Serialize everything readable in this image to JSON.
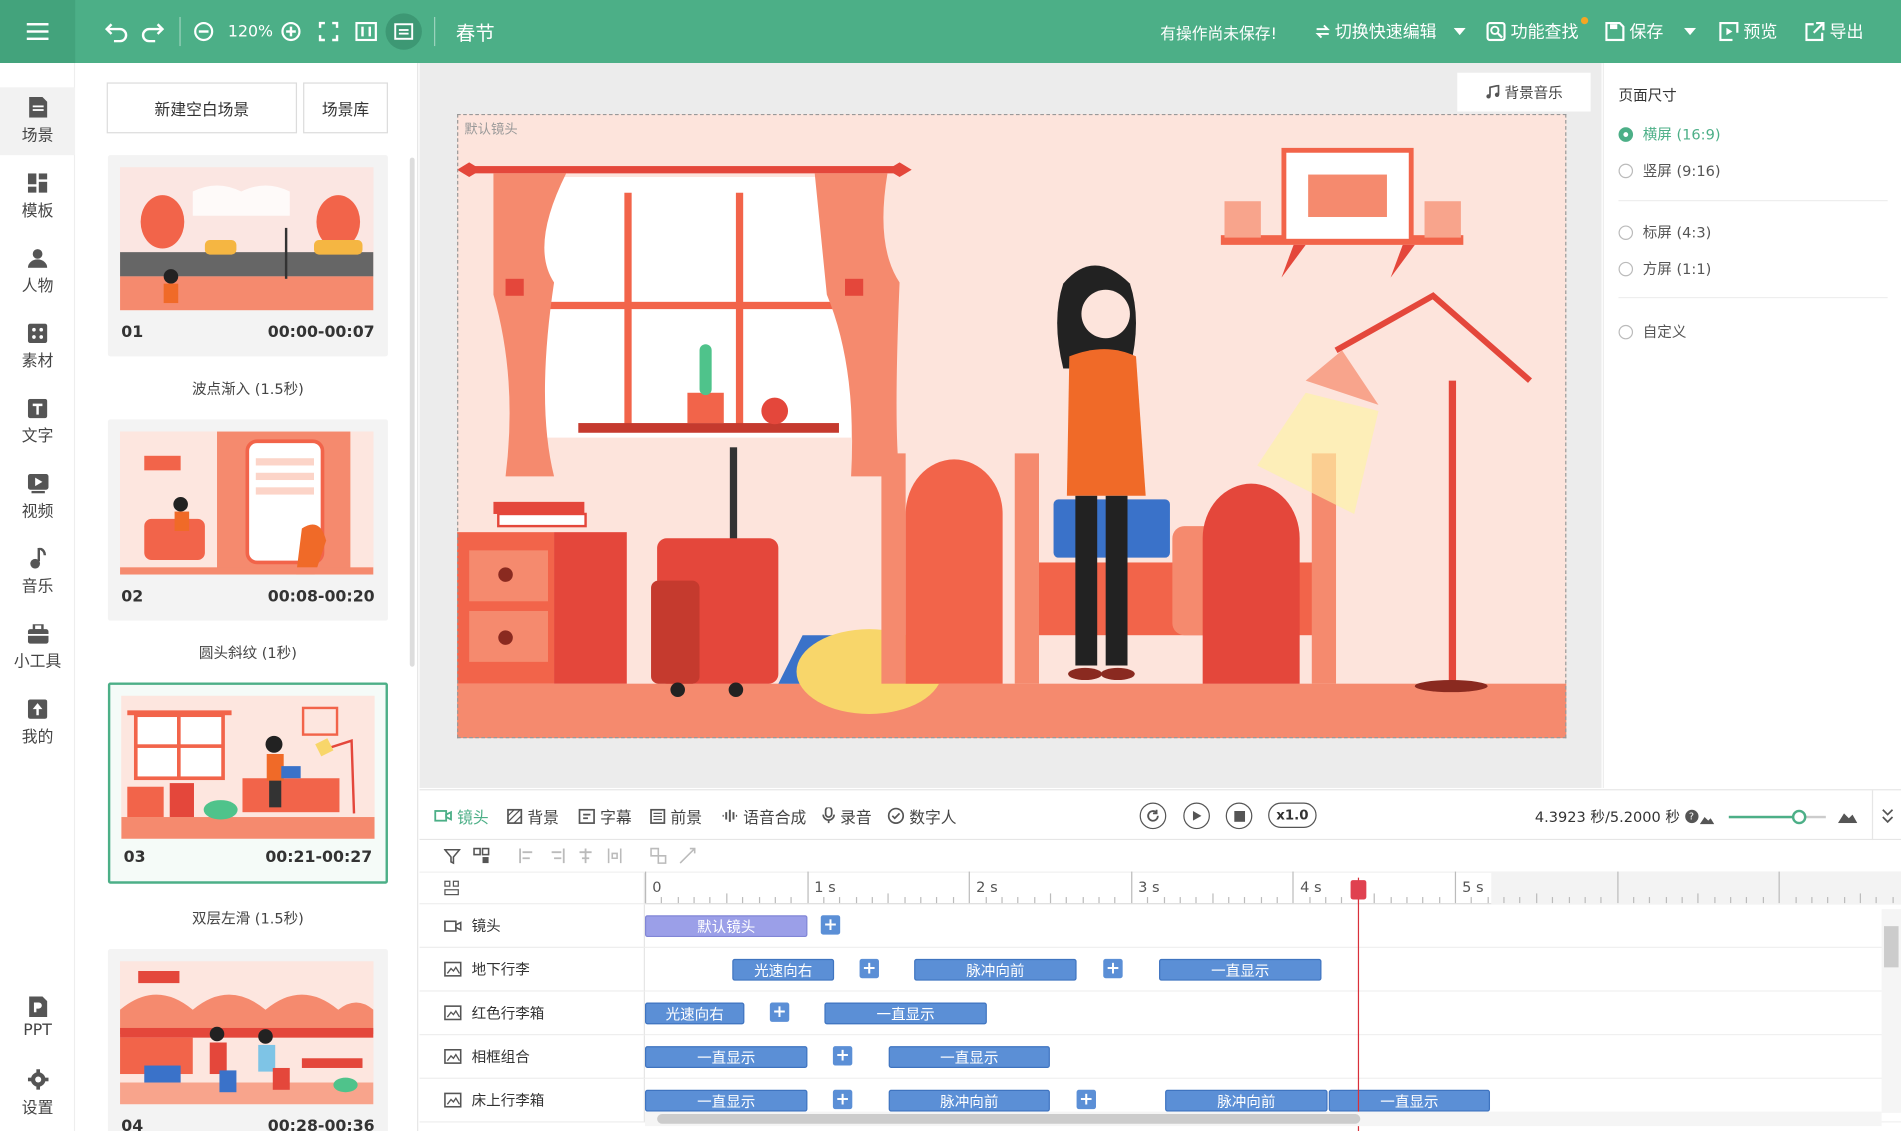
{
  "toolbar": {
    "zoom": "120%",
    "doc_title": "春节",
    "unsaved_notice": "有操作尚未保存!",
    "quick_edit": "切换快速编辑",
    "feature_search": "功能查找",
    "save": "保存",
    "preview": "预览",
    "export": "导出"
  },
  "nav": {
    "items": [
      {
        "label": "场景",
        "icon": "scene-icon"
      },
      {
        "label": "模板",
        "icon": "template-icon"
      },
      {
        "label": "人物",
        "icon": "person-icon"
      },
      {
        "label": "素材",
        "icon": "material-icon"
      },
      {
        "label": "文字",
        "icon": "text-icon"
      },
      {
        "label": "视频",
        "icon": "video-icon"
      },
      {
        "label": "音乐",
        "icon": "music-icon"
      },
      {
        "label": "小工具",
        "icon": "toolbox-icon"
      },
      {
        "label": "我的",
        "icon": "upload-icon"
      },
      {
        "label": "PPT",
        "icon": "ppt-icon"
      },
      {
        "label": "设置",
        "icon": "gear-icon"
      }
    ]
  },
  "scenes": {
    "new_blank": "新建空白场景",
    "library": "场景库",
    "cards": [
      {
        "num": "01",
        "time": "00:00-00:07",
        "transition": "波点渐入 (1.5秒)"
      },
      {
        "num": "02",
        "time": "00:08-00:20",
        "transition": "圆头斜纹 (1秒)"
      },
      {
        "num": "03",
        "time": "00:21-00:27",
        "transition": "双层左滑 (1.5秒)"
      },
      {
        "num": "04",
        "time": "00:28-00:36"
      }
    ]
  },
  "canvas": {
    "bgm": "背景音乐",
    "lens_label": "默认镜头"
  },
  "page_size": {
    "title": "页面尺寸",
    "options": [
      {
        "label": "横屏 (16:9)",
        "selected": true
      },
      {
        "label": "竖屏 (9:16)",
        "selected": false
      },
      {
        "label": "标屏 (4:3)",
        "selected": false
      },
      {
        "label": "方屏 (1:1)",
        "selected": false
      },
      {
        "label": "自定义",
        "selected": false
      }
    ]
  },
  "timeline": {
    "tabs": [
      "镜头",
      "背景",
      "字幕",
      "前景",
      "语音合成",
      "录音",
      "数字人"
    ],
    "speed": "x1.0",
    "time_readout": "4.3923 秒/5.2000 秒",
    "zoom_level": 0.72,
    "ruler_labels": [
      "0",
      "1 s",
      "2 s",
      "3 s",
      "4 s",
      "5 s"
    ],
    "tracks": [
      {
        "name": "镜头",
        "clips": [
          "默认镜头"
        ]
      },
      {
        "name": "地下行李",
        "clips": [
          "光速向右",
          "脉冲向前",
          "一直显示"
        ]
      },
      {
        "name": "红色行李箱",
        "clips": [
          "光速向右",
          "一直显示"
        ]
      },
      {
        "name": "相框组合",
        "clips": [
          "一直显示",
          "一直显示"
        ]
      },
      {
        "name": "床上行李箱",
        "clips": [
          "一直显示",
          "脉冲向前",
          "脉冲向前",
          "一直显示"
        ]
      }
    ]
  },
  "colors": {
    "brand": "#4caf87",
    "clip": "#5b8fd6",
    "lens_clip": "#9b9fe8",
    "playhead": "#d9303a"
  }
}
